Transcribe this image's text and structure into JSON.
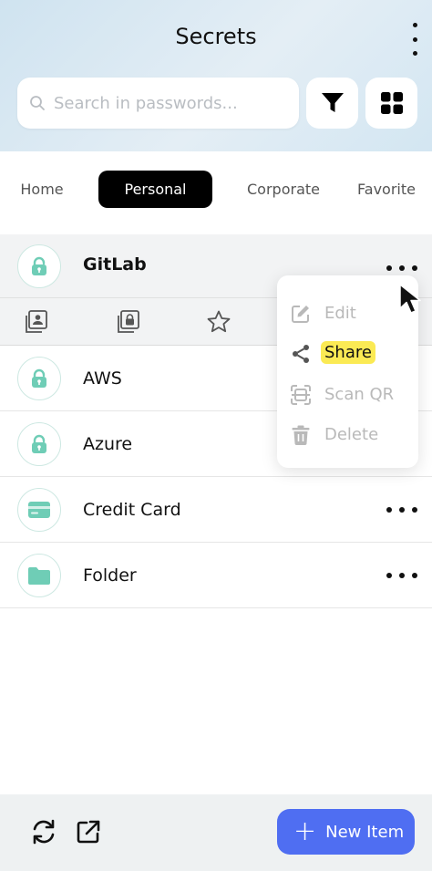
{
  "header": {
    "title": "Secrets"
  },
  "search": {
    "placeholder": "Search in passwords..."
  },
  "tabs": [
    {
      "label": "Home"
    },
    {
      "label": "Personal"
    },
    {
      "label": "Corporate"
    },
    {
      "label": "Favorite"
    }
  ],
  "active_tab": "Personal",
  "items": [
    {
      "name": "GitLab",
      "icon": "lock-icon",
      "expanded": true
    },
    {
      "name": "AWS",
      "icon": "lock-icon"
    },
    {
      "name": "Azure",
      "icon": "lock-icon"
    },
    {
      "name": "Credit Card",
      "icon": "credit-card-icon"
    },
    {
      "name": "Folder",
      "icon": "folder-icon"
    }
  ],
  "context_menu": {
    "items": [
      {
        "label": "Edit",
        "icon": "edit-icon",
        "enabled": false
      },
      {
        "label": "Share",
        "icon": "share-icon",
        "enabled": true,
        "highlighted": true
      },
      {
        "label": "Scan QR",
        "icon": "scan-qr-icon",
        "enabled": false
      },
      {
        "label": "Delete",
        "icon": "trash-icon",
        "enabled": false
      }
    ]
  },
  "footer": {
    "new_item_label": "New Item"
  },
  "colors": {
    "accent": "#4f6ef2",
    "teal": "#6fcdb6",
    "highlight": "#fbea54"
  }
}
